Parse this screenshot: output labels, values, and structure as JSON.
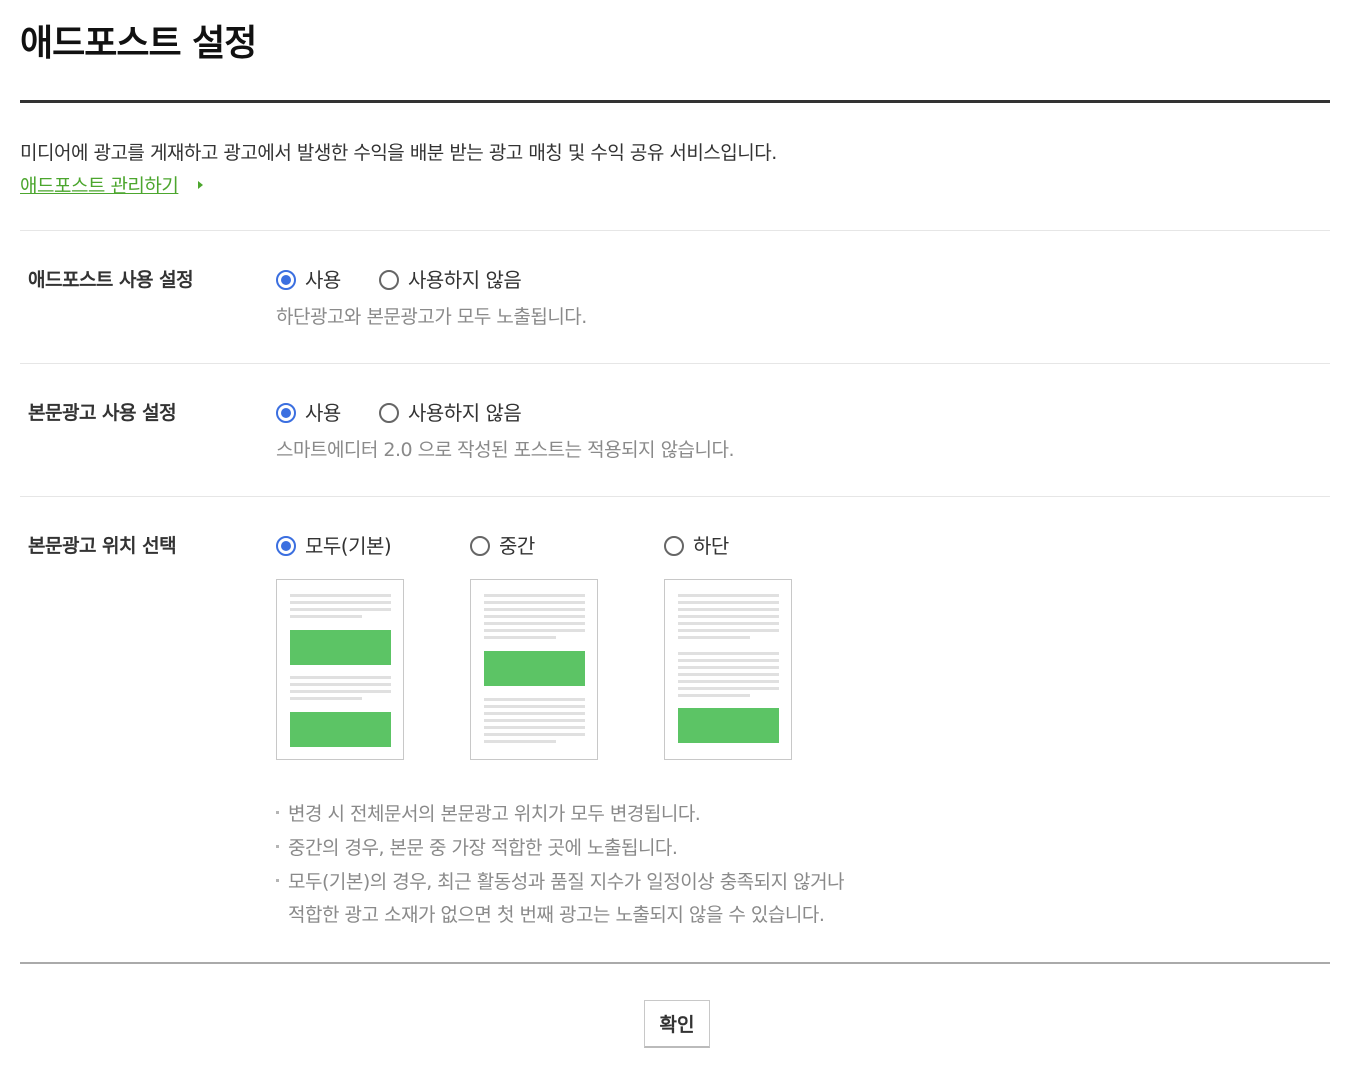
{
  "page": {
    "title": "애드포스트 설정",
    "intro": "미디어에 광고를 게재하고 광고에서 발생한 수익을 배분 받는 광고 매칭 및 수익 공유 서비스입니다.",
    "manage_link": "애드포스트 관리하기"
  },
  "settings": {
    "adpost_use": {
      "label": "애드포스트 사용 설정",
      "options": [
        "사용",
        "사용하지 않음"
      ],
      "selected": "사용",
      "description": "하단광고와 본문광고가 모두 노출됩니다."
    },
    "body_ad_use": {
      "label": "본문광고 사용 설정",
      "options": [
        "사용",
        "사용하지 않음"
      ],
      "selected": "사용",
      "description": "스마트에디터 2.0 으로 작성된 포스트는 적용되지 않습니다."
    },
    "body_ad_position": {
      "label": "본문광고 위치 선택",
      "options": [
        "모두(기본)",
        "중간",
        "하단"
      ],
      "selected": "모두(기본)",
      "notes": [
        "변경 시 전체문서의 본문광고 위치가 모두 변경됩니다.",
        "중간의 경우, 본문 중 가장 적합한 곳에 노출됩니다.",
        "모두(기본)의 경우, 최근 활동성과 품질 지수가 일정이상 충족되지 않거나",
        "적합한 광고 소재가 없으면 첫 번째 광고는 노출되지 않을 수 있습니다."
      ]
    }
  },
  "footer": {
    "confirm_label": "확인"
  },
  "colors": {
    "accent": "#3b6fe0",
    "link": "#4ca62e",
    "ad_block": "#5cc465"
  }
}
